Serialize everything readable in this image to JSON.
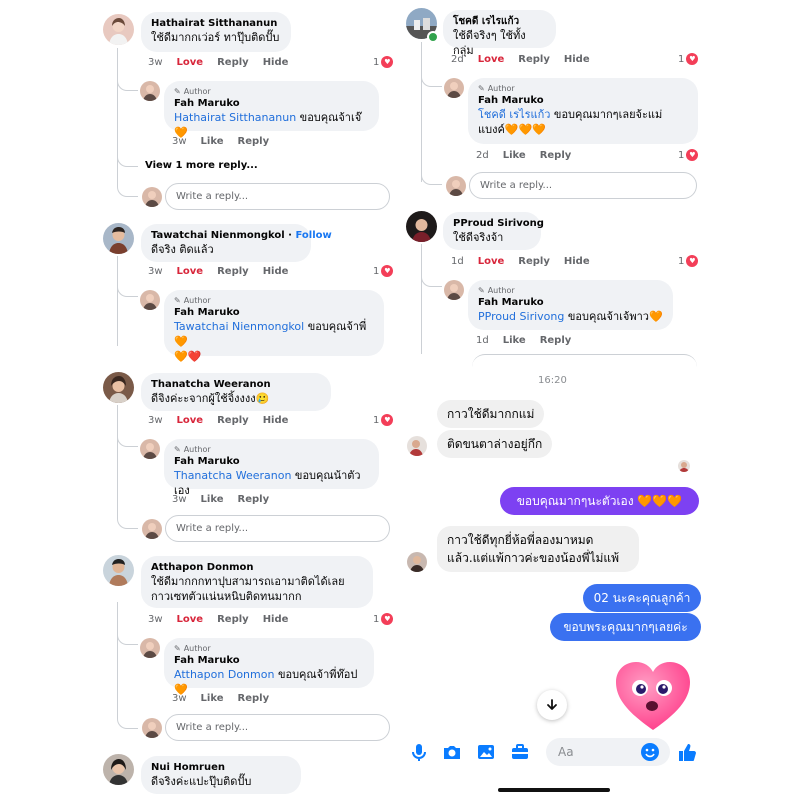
{
  "left": {
    "comments": [
      {
        "name": "Hathairat Sitthananun",
        "text": "ใช้ดีมากกเว่อร์ ทาปุ๊บติดปั๊บ",
        "time": "3w",
        "love": "Love",
        "reply": "Reply",
        "hide": "Hide",
        "reactions": "1",
        "author_reply": {
          "badge": "Author",
          "name": "Fah Maruko",
          "mention": "Hathairat Sitthananun",
          "text": " ขอบคุณจ้าเจ๊🧡",
          "time": "3w",
          "like": "Like",
          "reply": "Reply"
        },
        "more": "View 1 more reply..."
      },
      {
        "name": "Tawatchai Nienmongkol",
        "follow": "Follow",
        "text": "ดีจริง ติดแล้ว",
        "time": "3w",
        "love": "Love",
        "reply": "Reply",
        "hide": "Hide",
        "reactions": "1",
        "author_reply": {
          "badge": "Author",
          "name": "Fah Maruko",
          "mention": "Tawatchai Nienmongkol",
          "text": " ขอบคุณจ้าพี่🧡",
          "text2": "🧡❤️"
        }
      },
      {
        "name": "Thanatcha Weeranon",
        "text": "ดีจิงค่ะะจากผู้ใช้จิ้งงงง🥲",
        "time": "3w",
        "love": "Love",
        "reply": "Reply",
        "hide": "Hide",
        "reactions": "1",
        "author_reply": {
          "badge": "Author",
          "name": "Fah Maruko",
          "mention": "Thanatcha Weeranon",
          "text": " ขอบคุณน้าตัวเอง",
          "time": "3w",
          "like": "Like",
          "reply": "Reply"
        }
      },
      {
        "name": "Atthapon Donmon",
        "text": "ใช้ดีมากกกทาปุบสามารถเอามาติดได้เลยกาวเซทตัวแน่นหนิบติดทนมากก",
        "time": "3w",
        "love": "Love",
        "reply": "Reply",
        "hide": "Hide",
        "reactions": "1",
        "author_reply": {
          "badge": "Author",
          "name": "Fah Maruko",
          "mention": "Atthapon Donmon",
          "text": " ขอบคุณจ้าพี่ท๊อป🧡",
          "time": "3w",
          "like": "Like",
          "reply": "Reply"
        }
      },
      {
        "name": "Nui Homruen",
        "text": "ดีจริงค่ะแปะปุ๊บติดปั๊บ"
      }
    ],
    "write_reply": "Write a reply..."
  },
  "right": {
    "comments": [
      {
        "name": "โชคดี เรไรแก้ว",
        "text": "ใช้ดีจริงๆ ใช้ทั้งกลุ่ม",
        "time": "2d",
        "love": "Love",
        "reply": "Reply",
        "hide": "Hide",
        "reactions": "1",
        "author_reply": {
          "badge": "Author",
          "name": "Fah Maruko",
          "mention": "โชคดี เรไรแก้ว",
          "text": " ขอบคุณมากๆเลยจ้ะแม่",
          "text2": "แบงค์🧡🧡🧡",
          "time": "2d",
          "like": "Like",
          "reply": "Reply",
          "reactions": "1"
        }
      },
      {
        "name": "PProud Sirivong",
        "text": "ใช้ดีจริงจ้า",
        "time": "1d",
        "love": "Love",
        "reply": "Reply",
        "hide": "Hide",
        "reactions": "1",
        "author_reply": {
          "badge": "Author",
          "name": "Fah Maruko",
          "mention": "PProud Sirivong",
          "text": " ขอบคุณจ้าเจ้พาว🧡",
          "time": "1d",
          "like": "Like",
          "reply": "Reply"
        }
      }
    ],
    "write_reply": "Write a reply...",
    "chat": {
      "time": "16:20",
      "in1": "กาวใช้ดีมากกแม่",
      "in2": "ติดขนตาล่างอยู่กึก",
      "out1": "ขอบคุณมากๆนะตัวเอง 🧡🧡🧡",
      "in3a": "กาวใช้ดีทุกยี่ห้อพี่ลองมาหมด",
      "in3b": "แล้ว.แต่แพ้กาวค่ะของน้องพี่ไม่แพ้",
      "out2": "02 นะคะคุณลูกค้า",
      "out3": "ขอบพระคุณมากๆเลยค่ะ",
      "input_placeholder": "Aa"
    }
  },
  "colors": {
    "love": "#d8263b",
    "mention": "#216fdb",
    "messenger_out": "#5b4ff5",
    "messenger_blue": "#0a7cff"
  }
}
